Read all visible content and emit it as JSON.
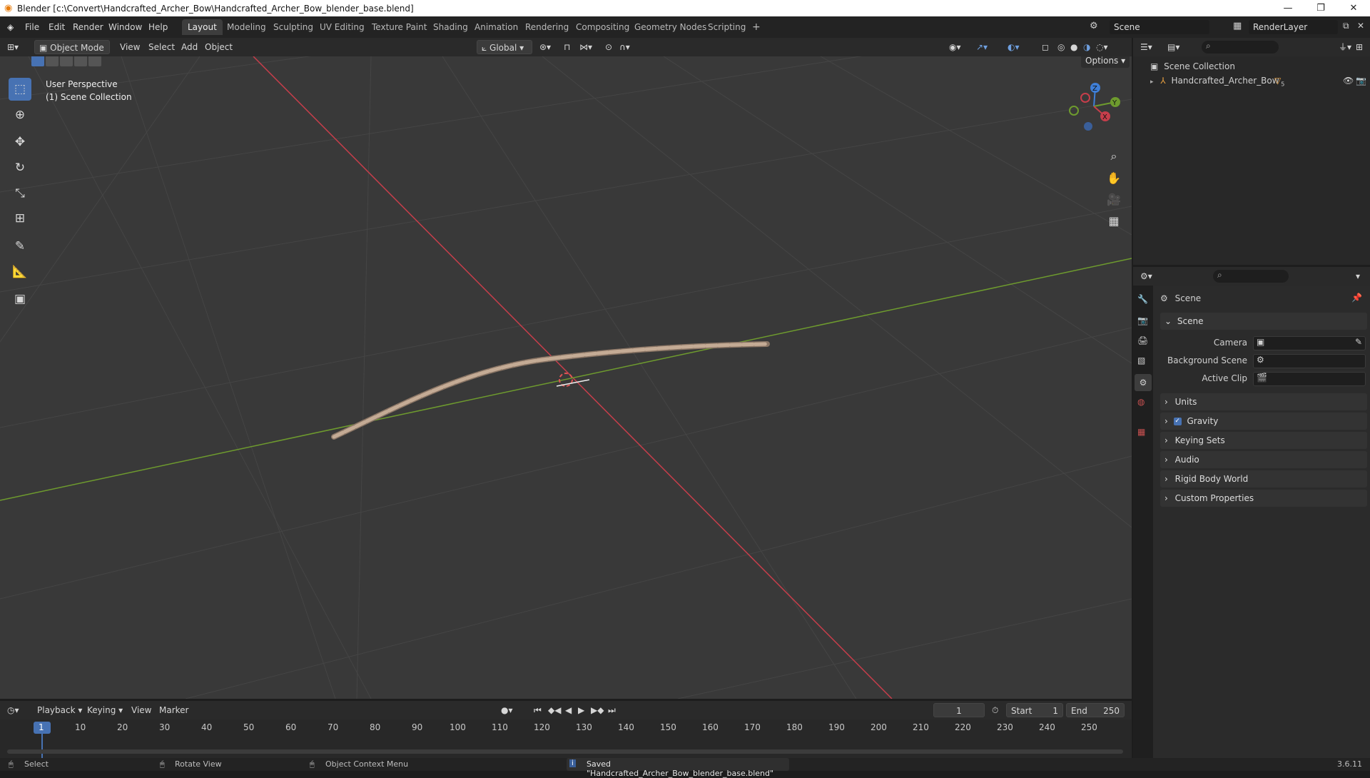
{
  "window": {
    "title": "Blender [c:\\Convert\\Handcrafted_Archer_Bow\\Handcrafted_Archer_Bow_blender_base.blend]",
    "controls": [
      "—",
      "❐",
      "✕"
    ]
  },
  "menu": [
    "File",
    "Edit",
    "Render",
    "Window",
    "Help"
  ],
  "workspaces": [
    "Layout",
    "Modeling",
    "Sculpting",
    "UV Editing",
    "Texture Paint",
    "Shading",
    "Animation",
    "Rendering",
    "Compositing",
    "Geometry Nodes",
    "Scripting",
    "+"
  ],
  "active_workspace": "Layout",
  "scene_selector": "Scene",
  "renderlayer_selector": "RenderLayer",
  "viewport_header": {
    "mode": "Object Mode",
    "menus": [
      "View",
      "Select",
      "Add",
      "Object"
    ],
    "transform_orientation": "Global",
    "options": "Options"
  },
  "viewport": {
    "perspective": "User Perspective",
    "collection": "(1) Scene Collection",
    "gizmo_axes": [
      "Z",
      "Y",
      "X"
    ]
  },
  "outliner": {
    "root": "Scene Collection",
    "items": [
      {
        "name": "Handcrafted_Archer_Bow",
        "badge": "5"
      }
    ]
  },
  "properties": {
    "title": "Scene",
    "panel_scene": "Scene",
    "fields": [
      {
        "label": "Camera",
        "value": ""
      },
      {
        "label": "Background Scene",
        "value": ""
      },
      {
        "label": "Active Clip",
        "value": ""
      }
    ],
    "panels": [
      "Units",
      "Gravity",
      "Keying Sets",
      "Audio",
      "Rigid Body World",
      "Custom Properties"
    ],
    "gravity_checked": true
  },
  "timeline": {
    "menus": [
      "Playback",
      "Keying",
      "View",
      "Marker"
    ],
    "current_frame": "1",
    "start_label": "Start",
    "start": "1",
    "end_label": "End",
    "end": "250",
    "ticks": [
      "1",
      "10",
      "20",
      "30",
      "40",
      "50",
      "60",
      "70",
      "80",
      "90",
      "100",
      "110",
      "120",
      "130",
      "140",
      "150",
      "160",
      "170",
      "180",
      "190",
      "200",
      "210",
      "220",
      "230",
      "240",
      "250"
    ]
  },
  "statusbar": {
    "select": "Select",
    "rotate": "Rotate View",
    "context": "Object Context Menu",
    "message": "Saved \"Handcrafted_Archer_Bow_blender_base.blend\"",
    "version": "3.6.11"
  },
  "colors": {
    "accent": "#4772b3",
    "x_axis": "#c73e4b",
    "y_axis": "#6e9b2e",
    "z_axis": "#3f7fd8"
  }
}
